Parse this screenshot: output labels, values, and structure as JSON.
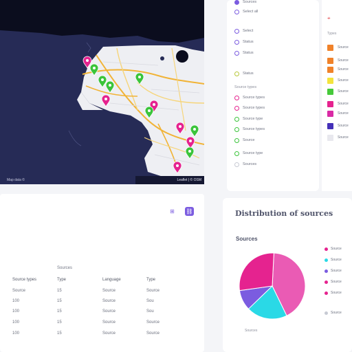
{
  "map": {
    "attribution_left": "Map data ©",
    "attribution_right": "Leaflet | © OSM",
    "pins": [
      {
        "color": "#e5238f",
        "label": "pink"
      },
      {
        "color": "#3bc43b",
        "label": "green"
      },
      {
        "color": "#3bc43b",
        "label": "green"
      },
      {
        "color": "#3bc43b",
        "label": "green"
      },
      {
        "color": "#e5238f",
        "label": "pink"
      },
      {
        "color": "#3bc43b",
        "label": "green"
      },
      {
        "color": "#e5238f",
        "label": "pink"
      },
      {
        "color": "#e5238f",
        "label": "pink"
      },
      {
        "color": "#3bc43b",
        "label": "green"
      },
      {
        "color": "#e5238f",
        "label": "pink"
      },
      {
        "color": "#3bc43b",
        "label": "green"
      },
      {
        "color": "#3bc43b",
        "label": "green"
      },
      {
        "color": "#e5238f",
        "label": "pink"
      }
    ]
  },
  "filters": {
    "top_item": "Sources",
    "first_group": [
      {
        "label": "Select all",
        "color": "#7b5ce0"
      },
      {
        "label": "Select",
        "color": "#7b5ce0"
      },
      {
        "label": "Status",
        "color": "#7b5ce0"
      },
      {
        "label": "Status",
        "color": "#7b5ce0"
      },
      {
        "label": "Status",
        "color": "#b7c83a"
      }
    ],
    "second_header": "Source types",
    "second_group": [
      {
        "label": "Source types",
        "color": "#e5238f"
      },
      {
        "label": "Source types",
        "color": "#e5238f"
      },
      {
        "label": "Source type",
        "color": "#3bc43b"
      },
      {
        "label": "Source types",
        "color": "#3bc43b"
      },
      {
        "label": "Source",
        "color": "#3bc43b"
      },
      {
        "label": "Source type",
        "color": "#3bc43b"
      },
      {
        "label": "Sources",
        "color": "#c7cad3"
      }
    ]
  },
  "legend": {
    "icon": "map-marker-icon",
    "header": "Types",
    "items": [
      {
        "label": "Source",
        "color": "#f0822a"
      },
      {
        "label": "Source",
        "color": "#f0822a"
      },
      {
        "label": "Source",
        "color": "#f0822a"
      },
      {
        "label": "Source",
        "color": "#f3e33d"
      },
      {
        "label": "Source",
        "color": "#46c93a"
      },
      {
        "label": "Source",
        "color": "#e5238f"
      },
      {
        "label": "Source",
        "color": "#d92aa5"
      },
      {
        "label": "Source",
        "color": "#4430b8"
      },
      {
        "label": "Source",
        "color": "#e8e8ee"
      }
    ]
  },
  "table": {
    "group_label": "Sources",
    "headers": [
      "Source types",
      "Type",
      "Language",
      "Type"
    ],
    "rows": [
      [
        "Source",
        "15",
        "Source",
        "Source"
      ],
      [
        "100",
        "15",
        "Source",
        "Sou"
      ],
      [
        "100",
        "15",
        "Source",
        "Sou"
      ],
      [
        "100",
        "15",
        "Source",
        "Source"
      ],
      [
        "100",
        "15",
        "Source",
        "Source"
      ]
    ]
  },
  "chart_card": {
    "title": "Distribution of sources",
    "subtitle": "Sources",
    "footer": "Sources"
  },
  "chart_data": {
    "type": "pie",
    "title": "Distribution of sources",
    "series": [
      {
        "name": "Source",
        "color": "#ea5bb4",
        "value": 42
      },
      {
        "name": "Source",
        "color": "#2ad9e6",
        "value": 20
      },
      {
        "name": "Source",
        "color": "#7b5ce0",
        "value": 10
      },
      {
        "name": "Source",
        "color": "#e5238f",
        "value": 28
      }
    ],
    "legend_labels": [
      "Source",
      "Source",
      "Source",
      "Source",
      "Source",
      "Source"
    ],
    "legend_colors": [
      "#e5238f",
      "#2ad9e6",
      "#7b5ce0",
      "#e5238f",
      "#e5238f",
      "#c7cad3"
    ]
  }
}
